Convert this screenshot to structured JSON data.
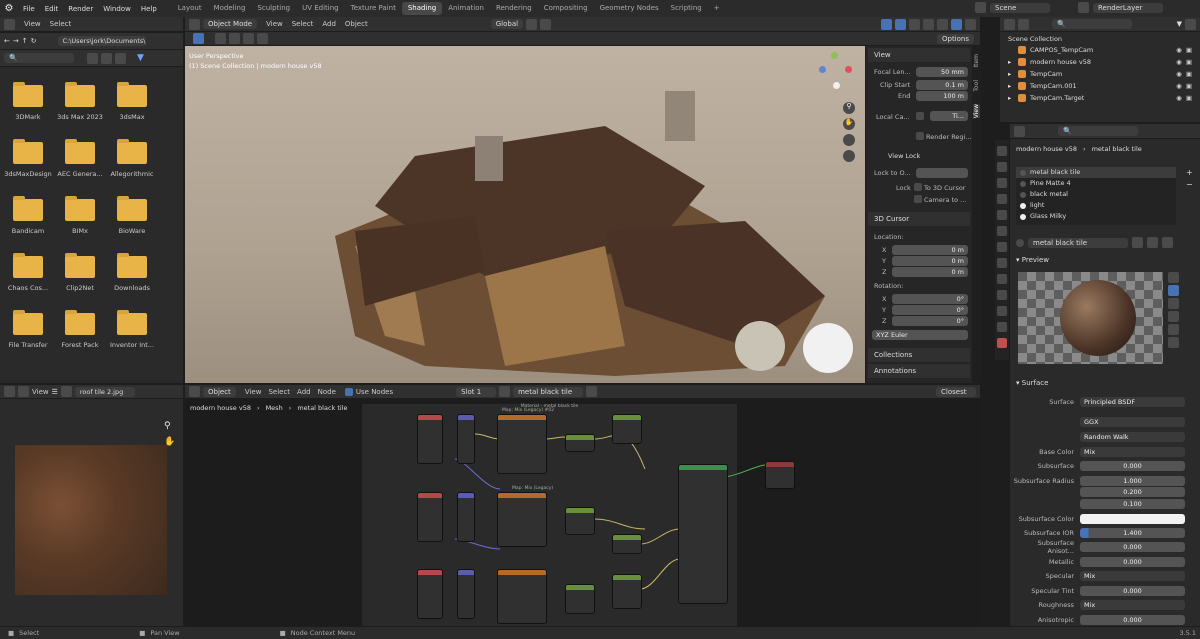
{
  "topbar": {
    "menus": [
      "File",
      "Edit",
      "Render",
      "Window",
      "Help"
    ],
    "workspaces": [
      "Layout",
      "Modeling",
      "Sculpting",
      "UV Editing",
      "Texture Paint",
      "Shading",
      "Animation",
      "Rendering",
      "Compositing",
      "Geometry Nodes",
      "Scripting"
    ],
    "active_workspace": "Shading",
    "add_tab": "+",
    "scene": "Scene",
    "render_layer": "RenderLayer"
  },
  "file_browser": {
    "menus": [
      "View",
      "Select"
    ],
    "path": "C:\\Users\\jork\\Documents\\",
    "folders": [
      "3DMark",
      "3ds Max 2023",
      "3dsMax",
      "3dsMaxDesign",
      "AEC Genera...",
      "Allegorithmic",
      "Bandicam",
      "BIMx",
      "BioWare",
      "Chaos Cos...",
      "Clip2Net",
      "Downloads",
      "File Transfer",
      "Forest Pack",
      "Inventor Int..."
    ]
  },
  "viewport": {
    "mode": "Object Mode",
    "menus": [
      "View",
      "Select",
      "Add",
      "Object"
    ],
    "orientation": "Global",
    "options": "Options",
    "overlay_line1": "User Perspective",
    "overlay_line2": "(1) Scene Collection | modern house v58",
    "side_tabs": [
      "Item",
      "Tool",
      "View"
    ]
  },
  "npanel": {
    "view_title": "View",
    "focal_label": "Focal Len...",
    "focal_value": "50 mm",
    "clip_start_label": "Clip Start",
    "clip_start_value": "0.1 m",
    "end_label": "End",
    "end_value": "100 m",
    "local_camera_label": "Local Ca...",
    "local_camera_value": "Ti...",
    "render_region": "Render Regi...",
    "view_lock_title": "View Lock",
    "lock_to_label": "Lock to O...",
    "lock_label": "Lock",
    "to_3d_cursor": "To 3D Cursor",
    "camera_to": "Camera to ...",
    "cursor_title": "3D Cursor",
    "location_label": "Location:",
    "loc": [
      {
        "axis": "X",
        "value": "0 m"
      },
      {
        "axis": "Y",
        "value": "0 m"
      },
      {
        "axis": "Z",
        "value": "0 m"
      }
    ],
    "rotation_label": "Rotation:",
    "rot": [
      {
        "axis": "X",
        "value": "0°"
      },
      {
        "axis": "Y",
        "value": "0°"
      },
      {
        "axis": "Z",
        "value": "0°"
      }
    ],
    "rot_mode": "XYZ Euler",
    "collections": "Collections",
    "annotations": "Annotations"
  },
  "image_editor": {
    "menus": [
      "View"
    ],
    "image_name": "roof tile 2.jpg"
  },
  "node_editor": {
    "type": "Object",
    "menus": [
      "View",
      "Select",
      "Add",
      "Node"
    ],
    "use_nodes": "Use Nodes",
    "slot": "Slot 1",
    "material": "metal black tile",
    "breadcrumbs": [
      "modern house v58",
      "Mesh",
      "metal black tile"
    ],
    "snap": "Closest",
    "frame_label_top": "Material - metal black tile",
    "frame_label_top2": "Map: Mix (Legacy) #02",
    "frame_label_mid": "Map: Mix (Legacy)"
  },
  "outliner": {
    "title": "Scene Collection",
    "items": [
      "CAMPOS_TempCam",
      "modern house v58",
      "TempCam",
      "TempCam.001",
      "TempCam.Target"
    ]
  },
  "properties": {
    "object_name": "modern house v58",
    "material_name": "metal black tile",
    "slots": [
      "metal black tile",
      "Pine Matte 4",
      "black metal",
      "light",
      "Glass Milky"
    ],
    "material_field": "metal black tile",
    "preview_title": "Preview",
    "surface_title": "Surface",
    "surface_label": "Surface",
    "surface_value": "Principled BSDF",
    "distribution": "GGX",
    "subsurface_method": "Random Walk",
    "rows": [
      {
        "label": "Base Color",
        "value": "Mix"
      },
      {
        "label": "Subsurface",
        "value": "0.000"
      },
      {
        "label": "Subsurface Radius",
        "value": "1.000"
      },
      {
        "label": "",
        "value": "0.200"
      },
      {
        "label": "",
        "value": "0.100"
      },
      {
        "label": "Subsurface Color",
        "value": ""
      },
      {
        "label": "Subsurface IOR",
        "value": "1.400"
      },
      {
        "label": "Subsurface Anisot...",
        "value": "0.000"
      },
      {
        "label": "Metallic",
        "value": "0.000"
      },
      {
        "label": "Specular",
        "value": "Mix"
      },
      {
        "label": "Specular Tint",
        "value": "0.000"
      },
      {
        "label": "Roughness",
        "value": "Mix"
      },
      {
        "label": "Anisotropic",
        "value": "0.000"
      }
    ]
  },
  "status": {
    "select": "Select",
    "pan": "Pan View",
    "node_menu": "Node Context Menu",
    "version": "3.5.1"
  },
  "colors": {
    "accent": "#4772b3",
    "folder": "#e8b447",
    "active_tab": "#484848"
  }
}
